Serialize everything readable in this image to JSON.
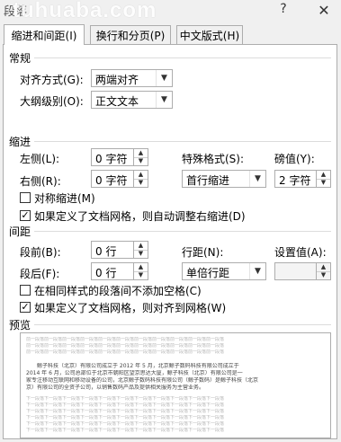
{
  "window": {
    "title": "段落",
    "watermark": "tuhuaba.com",
    "help_glyph": "?",
    "close_glyph": "✕"
  },
  "tabs": [
    {
      "label": "缩进和间距(I)",
      "active": true
    },
    {
      "label": "换行和分页(P)",
      "active": false
    },
    {
      "label": "中文版式(H)",
      "active": false
    }
  ],
  "general": {
    "title": "常规",
    "alignment_label": "对齐方式(G):",
    "alignment_value": "两端对齐",
    "outline_label": "大纲级别(O):",
    "outline_value": "正文文本"
  },
  "indent": {
    "title": "缩进",
    "left_label": "左侧(L):",
    "left_value": "0 字符",
    "right_label": "右侧(R):",
    "right_value": "0 字符",
    "special_label": "特殊格式(S):",
    "special_value": "首行缩进",
    "by_label": "磅值(Y):",
    "by_value": "2 字符",
    "mirror_label": "对称缩进(M)",
    "mirror_checked": false,
    "auto_adjust_label": "如果定义了文档网格，则自动调整右缩进(D)",
    "auto_adjust_checked": true
  },
  "spacing": {
    "title": "间距",
    "before_label": "段前(B):",
    "before_value": "0 行",
    "after_label": "段后(F):",
    "after_value": "0 行",
    "line_label": "行距(N):",
    "line_value": "单倍行距",
    "at_label": "设置值(A):",
    "at_value": "",
    "no_space_label": "在相同样式的段落间不添加空格(C)",
    "no_space_checked": false,
    "snap_grid_label": "如果定义了文档网格，则对齐到网格(W)",
    "snap_grid_checked": true
  },
  "preview": {
    "title": "预览",
    "prev_line": "前一段落前一段落前一段落前一段落前一段落前一段落前一段落前一段落前一段落前一段落前一段落",
    "sample_lines": [
      "鲸子科技（北京）有限公司成立于 2012 年 5 月，北京鲸子数码科技有限公司成立于",
      "2014 年 6 月，公司总部位于北京市朝阳区望京思达大厦，鲸子科技（北京）有限公司是一",
      "家专注移动互联网和移动设备的公司，北京鲸子数码科技有限公司（鲸子数码）是鲸子科技（北京",
      "京）有限公司的全资子公司，以销售数码产品及提供相关服务为主营业务。"
    ],
    "next_line": "下一段落下一段落下一段落下一段落下一段落下一段落下一段落下一段落下一段落下一段落下一段落"
  }
}
